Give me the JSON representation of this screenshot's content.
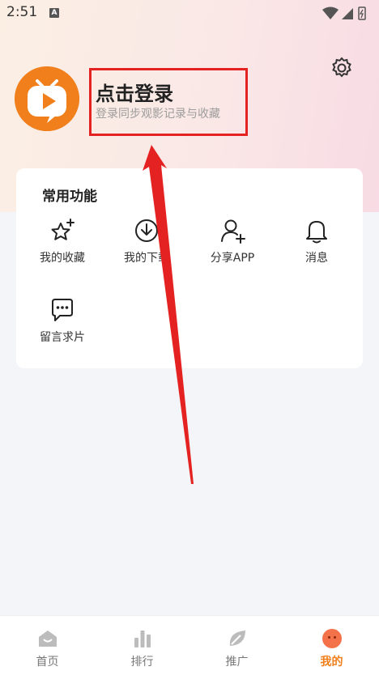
{
  "status_bar": {
    "time": "2:51",
    "badge": "A"
  },
  "header": {
    "login_title": "点击登录",
    "login_subtitle": "登录同步观影记录与收藏"
  },
  "features": {
    "title": "常用功能",
    "items": [
      {
        "label": "我的收藏",
        "icon": "star-sparkle-icon"
      },
      {
        "label": "我的下载",
        "icon": "download-icon"
      },
      {
        "label": "分享APP",
        "icon": "add-user-icon"
      },
      {
        "label": "消息",
        "icon": "bell-icon"
      },
      {
        "label": "留言求片",
        "icon": "message-icon"
      }
    ]
  },
  "tabbar": {
    "items": [
      {
        "label": "首页",
        "icon": "home-icon"
      },
      {
        "label": "排行",
        "icon": "bar-chart-icon"
      },
      {
        "label": "推广",
        "icon": "leaf-icon"
      },
      {
        "label": "我的",
        "icon": "profile-face-icon"
      }
    ],
    "active_color": "#f07f1c"
  },
  "colors": {
    "accent": "#f07f1c",
    "annotation": "#e52222"
  }
}
